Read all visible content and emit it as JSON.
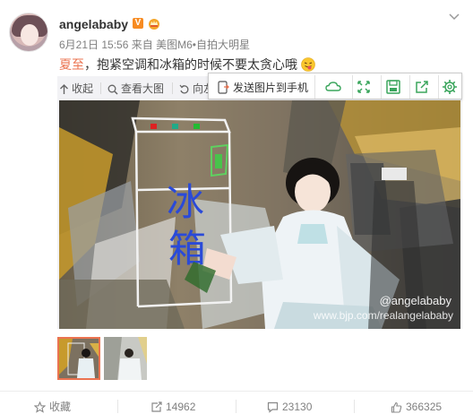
{
  "post": {
    "username": "angelababy",
    "verified_badge": "V",
    "time": "6月21日 15:56",
    "source": "来自 美图M6•自拍大明星",
    "topic_tag": "夏至",
    "text": "，抱紧空调和冰箱的时候不要太贪心哦"
  },
  "media_toolbar": {
    "collapse_label": "收起",
    "view_large_label": "查看大图",
    "rotate_label": "向左转"
  },
  "popup": {
    "send_to_phone_label": "发送图片到手机",
    "icons": [
      "cloud-icon",
      "fullscreen-icon",
      "save-icon",
      "share-icon",
      "settings-icon"
    ]
  },
  "photo": {
    "drawn_text_top": "冰",
    "drawn_text_bottom": "箱",
    "watermark_handle": "@angelababy",
    "watermark_url": "www.bjp.com/realangelababy"
  },
  "thumbnails": [
    {
      "selected": true
    },
    {
      "selected": false
    }
  ],
  "footer": {
    "favorite_label": "收藏",
    "repost_count": "14962",
    "comment_count": "23130",
    "like_count": "366325"
  },
  "colors": {
    "accent": "#eb7350",
    "badge": "#f78b22",
    "toolbar_green": "#3aa55c"
  }
}
